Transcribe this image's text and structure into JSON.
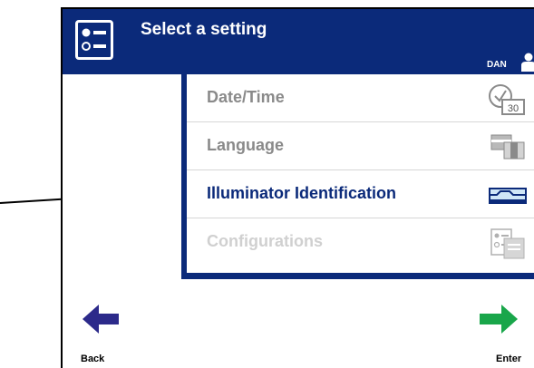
{
  "header": {
    "title": "Select a setting",
    "user": "DAN"
  },
  "menu": {
    "items": [
      {
        "label": "Date/Time",
        "state": "muted",
        "icon": "calendar-clock-icon",
        "day": "30"
      },
      {
        "label": "Language",
        "state": "muted",
        "icon": "language-flags-icon"
      },
      {
        "label": "Illuminator Identification",
        "state": "active",
        "icon": "illuminator-icon"
      },
      {
        "label": "Configurations",
        "state": "disabled",
        "icon": "configurations-icon"
      }
    ]
  },
  "nav": {
    "back_label": "Back",
    "enter_label": "Enter"
  },
  "colors": {
    "header": "#0b2a7a",
    "back_arrow": "#2c2a8a",
    "enter_arrow": "#19a64a"
  }
}
